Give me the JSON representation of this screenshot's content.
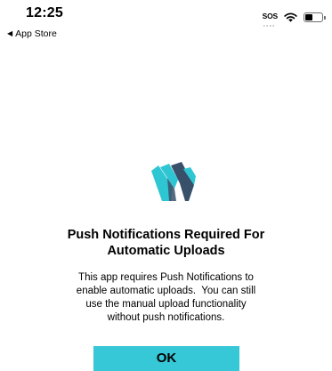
{
  "status_bar": {
    "time": "12:25",
    "back_label": "App Store",
    "back_icon": "back-triangle-icon",
    "carrier_text": "SOS",
    "wifi_icon": "wifi-icon",
    "battery_level": 0.45
  },
  "logo": {
    "icon": "app-logo-icon",
    "colors": [
      "#2fc6d3",
      "#38506a"
    ]
  },
  "dialog": {
    "title_lines": [
      "Push Notifications Required For",
      "Automatic Uploads"
    ],
    "message_lines": [
      "This app requires Push Notifications to",
      "enable automatic uploads.  You can still",
      "use the manual upload functionality",
      "without push notifications."
    ],
    "ok_label": "OK"
  },
  "colors": {
    "accent": "#36c8d7",
    "text": "#000000",
    "background": "#ffffff"
  }
}
